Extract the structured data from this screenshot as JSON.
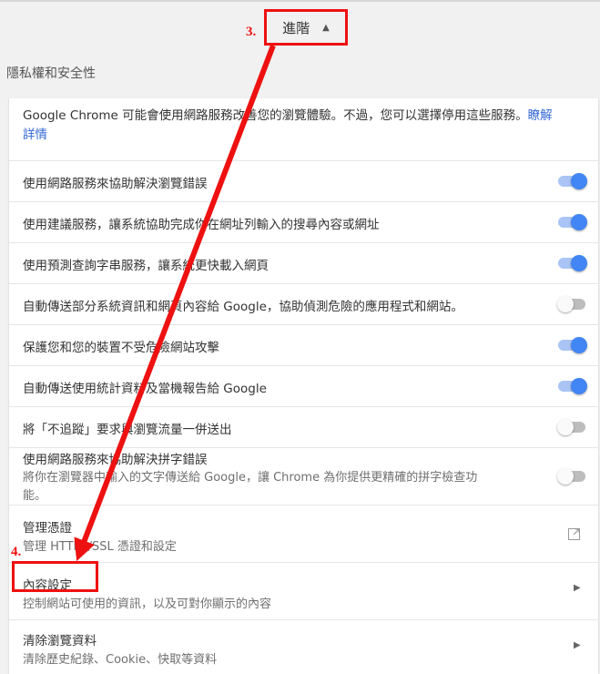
{
  "advanced": {
    "label": "進階"
  },
  "section_title": "隱私權和安全性",
  "intro": {
    "text": "Google Chrome 可能會使用網路服務改善您的瀏覽體驗。不過，您可以選擇停用這些服務。",
    "link_part1": "瞭解",
    "link_part2": "詳情"
  },
  "settings": [
    {
      "label": "使用網路服務來協助解決瀏覽錯誤",
      "state": "on"
    },
    {
      "label": "使用建議服務，讓系統協助完成你在網址列輸入的搜尋內容或網址",
      "state": "on"
    },
    {
      "label": "使用預測查詢字串服務，讓系統更快載入網頁",
      "state": "on"
    },
    {
      "label": "自動傳送部分系統資訊和網頁內容給 Google，協助偵測危險的應用程式和網站。",
      "state": "off"
    },
    {
      "label": "保護您和您的裝置不受危險網站攻擊",
      "state": "on"
    },
    {
      "label": "自動傳送使用統計資料及當機報告給 Google",
      "state": "on"
    },
    {
      "label": "將「不追蹤」要求與瀏覽流量一併送出",
      "state": "off"
    }
  ],
  "spell": {
    "label": "使用網路服務來協助解決拼字錯誤",
    "desc_line1": "將你在瀏覽器中輸入的文字傳送給 Google，讓 Chrome 為你提供更精確的拼字檢查功",
    "desc_line2": "能。",
    "state": "off"
  },
  "certificates": {
    "label": "管理憑證",
    "desc": "管理 HTTPS/SSL 憑證和設定"
  },
  "content_settings": {
    "label": "內容設定",
    "desc": "控制網站可使用的資訊，以及可對你顯示的內容"
  },
  "clear_data": {
    "label": "清除瀏覽資料",
    "desc": "清除歷史紀錄、Cookie、快取等資料"
  },
  "annotations": {
    "step3": "3.",
    "step4": "4."
  },
  "colors": {
    "accent": "#4285f4",
    "annotation": "#ee1111",
    "link": "#3367d6"
  }
}
